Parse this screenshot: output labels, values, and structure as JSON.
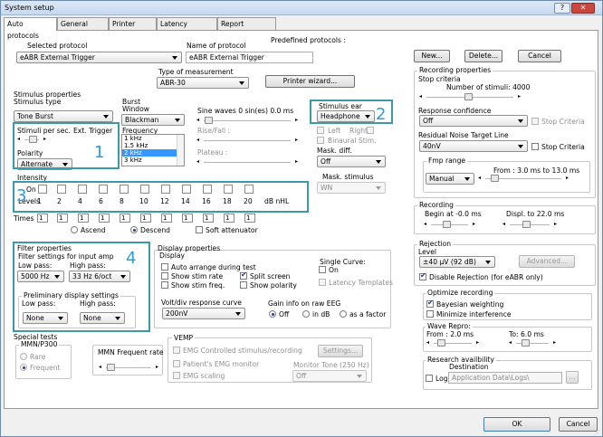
{
  "window": {
    "title": "System setup",
    "help": "?",
    "close": "✕"
  },
  "tabs": [
    "Auto protocols",
    "General Setup",
    "Printer Setup",
    "Latency Template",
    "Report Templates"
  ],
  "top": {
    "selected_label": "Selected protocol",
    "selected_value": "eABR External Trigger",
    "name_label": "Name of protocol",
    "name_value": "eABR External Trigger",
    "predef_label": "Predefined protocols :",
    "new": "New...",
    "delete": "Delete...",
    "cancel": "Cancel"
  },
  "mtype": {
    "label": "Type of measurement",
    "value": "ABR-30",
    "printer": "Printer wizard..."
  },
  "stim": {
    "group": "Stimulus properties",
    "type_label": "Stimulus type",
    "type_value": "Tone Burst",
    "burst_label": "Burst",
    "window_label": "Window",
    "window_value": "Blackman",
    "sine_label": "Sine waves 0 sin(es) 0.0 ms",
    "freq_label": "Frequency",
    "freq_items": [
      "1 kHz",
      "1.5 kHz",
      "2 kHz",
      "3 kHz"
    ],
    "rise_label": "Rise/Fall :",
    "plateau_label": "Plateau :",
    "rate_label": "Stimuli per sec.",
    "ext_label": "Ext. Trigger",
    "polarity_label": "Polarity",
    "polarity_value": "Alternate",
    "ear_label": "Stimulus ear",
    "ear_value": "Headphone",
    "left": "Left",
    "right": "Right",
    "binaural": "Binaural Stim.",
    "mask_label": "Mask. diff.",
    "mask_value": "Off",
    "mstim_label": "Mask. stimulus",
    "mstim_value": "WN",
    "intensity_label": "Intensity",
    "on_label": "On",
    "levels_label": "Levels",
    "levels": [
      "1",
      "2",
      "4",
      "6",
      "8",
      "10",
      "12",
      "14",
      "16",
      "18",
      "20"
    ],
    "unit": "dB nHL",
    "times_label": "Times :",
    "times": [
      "1",
      "1",
      "1",
      "1",
      "1",
      "1",
      "1",
      "1",
      "1",
      "1",
      "1"
    ],
    "asc": "Ascend",
    "desc": "Descend",
    "soft": "Soft attenuator"
  },
  "rec": {
    "group": "Recording properties",
    "stop": "Stop criteria",
    "nstim": "Number of stimuli: 4000",
    "resp_label": "Response confidence",
    "resp_value": "Off",
    "stop_crit": "Stop Criteria",
    "rnsl_label": "Residual Noise Target Line",
    "rnsl_value": "40nV",
    "fmp_label": "Fmp range",
    "fmp_value": "Manual",
    "fmp_range": "From : 3.0 ms to 13.0 ms"
  },
  "recording": {
    "label": "Recording",
    "begin": "Begin at  -0.0 ms",
    "displ": "Displ. to  22.0 ms"
  },
  "rejection": {
    "label": "Rejection",
    "level_label": "Level",
    "level_value": "±40 µV (92 dB)",
    "advanced": "Advanced...",
    "disable": "Disable Rejection (for eABR only)"
  },
  "optimize": {
    "label": "Optimize recording",
    "bayes": "Bayesian weighting",
    "min": "Minimize interference"
  },
  "wave": {
    "label": "Wave Repro:",
    "from": "From :  2.0 ms",
    "to": "To:  6.0 ms"
  },
  "research": {
    "label": "Research availbility",
    "dest": "Destination",
    "log": "Log",
    "path": "Application Data\\Logs\\",
    "browse": "..."
  },
  "filter": {
    "group": "Filter properties",
    "input_label": "Filter settings for input amp",
    "low_label": "Low pass:",
    "high_label": "High pass:",
    "low_value": "5000 Hz",
    "high_value": "33 Hz 6/oct",
    "pre_label": "Preliminary display settings",
    "pre_low_label": "Low pass:",
    "pre_high_label": "High pass:",
    "pre_low": "None",
    "pre_high": "None"
  },
  "display": {
    "group": "Display properties",
    "sub": "Display",
    "auto": "Auto arrange during test",
    "rate": "Show stim rate",
    "freq": "Show stim freq.",
    "split": "Split screen",
    "polarity": "Show polarity",
    "single": "Single Curve:",
    "on": "On",
    "latency": "Latency Templates",
    "volt_label": "Volt/div response curve",
    "volt_value": "200nV",
    "gain_label": "Gain info on raw EEG",
    "gain_off": "Off",
    "gain_db": "in dB",
    "gain_factor": "as a factor"
  },
  "special": {
    "group": "Special tests",
    "mmn": "MMN/P300",
    "rare": "Rare",
    "frequent": "Frequent",
    "mmn_rate": "MMN Frequent rate"
  },
  "vemp": {
    "group": "VEMP",
    "emg": "EMG Controlled stimulus/recording",
    "settings": "Settings...",
    "patient": "Patient's EMG monitor",
    "monitor_tone": "Monitor Tone (250 Hz)",
    "scaling": "EMG scaling",
    "scaling_value": "Off"
  },
  "footer": {
    "ok": "OK",
    "cancel": "Cancel"
  },
  "callouts": [
    "1",
    "2",
    "3",
    "4"
  ],
  "colors": {
    "callout": "#2b9bd5",
    "highlight": "#3a9aa6"
  }
}
